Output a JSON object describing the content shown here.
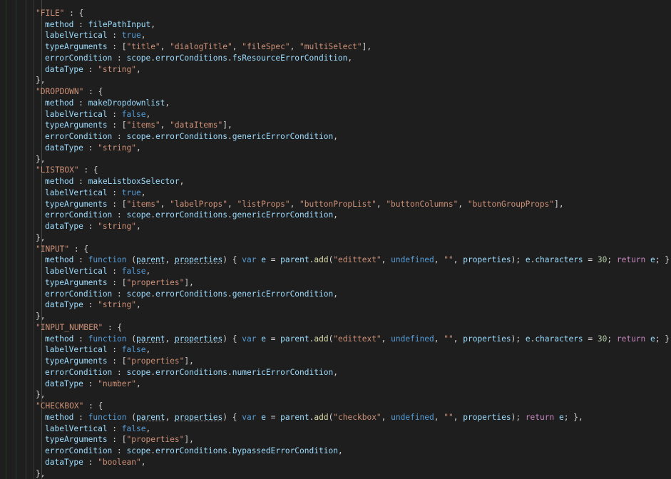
{
  "editor": {
    "lines": [
      [
        [
          "t",
          ""
        ]
      ],
      [
        [
          "s",
          "\"FILE\""
        ],
        [
          "t",
          " : {"
        ]
      ],
      [
        [
          "i",
          ""
        ],
        [
          "p",
          "method"
        ],
        [
          "t",
          " : "
        ],
        [
          "p",
          "filePathInput"
        ],
        [
          "t",
          ","
        ]
      ],
      [
        [
          "i",
          ""
        ],
        [
          "p",
          "labelVertical"
        ],
        [
          "t",
          " : "
        ],
        [
          "k",
          "true"
        ],
        [
          "t",
          ","
        ]
      ],
      [
        [
          "i",
          ""
        ],
        [
          "p",
          "typeArguments"
        ],
        [
          "t",
          " : ["
        ],
        [
          "s",
          "\"title\""
        ],
        [
          "t",
          ", "
        ],
        [
          "s",
          "\"dialogTitle\""
        ],
        [
          "t",
          ", "
        ],
        [
          "s",
          "\"fileSpec\""
        ],
        [
          "t",
          ", "
        ],
        [
          "s",
          "\"multiSelect\""
        ],
        [
          "t",
          "],"
        ]
      ],
      [
        [
          "i",
          ""
        ],
        [
          "p",
          "errorCondition"
        ],
        [
          "t",
          " : "
        ],
        [
          "p",
          "scope"
        ],
        [
          "t",
          "."
        ],
        [
          "p",
          "errorConditions"
        ],
        [
          "t",
          "."
        ],
        [
          "p",
          "fsResourceErrorCondition"
        ],
        [
          "t",
          ","
        ]
      ],
      [
        [
          "i",
          ""
        ],
        [
          "p",
          "dataType"
        ],
        [
          "t",
          " : "
        ],
        [
          "s",
          "\"string\""
        ],
        [
          "t",
          ","
        ]
      ],
      [
        [
          "t",
          "},"
        ]
      ],
      [
        [
          "s",
          "\"DROPDOWN\""
        ],
        [
          "t",
          " : {"
        ]
      ],
      [
        [
          "i",
          ""
        ],
        [
          "p",
          "method"
        ],
        [
          "t",
          " : "
        ],
        [
          "p",
          "makeDropdownlist"
        ],
        [
          "t",
          ","
        ]
      ],
      [
        [
          "i",
          ""
        ],
        [
          "p",
          "labelVertical"
        ],
        [
          "t",
          " : "
        ],
        [
          "k",
          "false"
        ],
        [
          "t",
          ","
        ]
      ],
      [
        [
          "i",
          ""
        ],
        [
          "p",
          "typeArguments"
        ],
        [
          "t",
          " : ["
        ],
        [
          "s",
          "\"items\""
        ],
        [
          "t",
          ", "
        ],
        [
          "s",
          "\"dataItems\""
        ],
        [
          "t",
          "],"
        ]
      ],
      [
        [
          "i",
          ""
        ],
        [
          "p",
          "errorCondition"
        ],
        [
          "t",
          " : "
        ],
        [
          "p",
          "scope"
        ],
        [
          "t",
          "."
        ],
        [
          "p",
          "errorConditions"
        ],
        [
          "t",
          "."
        ],
        [
          "p",
          "genericErrorCondition"
        ],
        [
          "t",
          ","
        ]
      ],
      [
        [
          "i",
          ""
        ],
        [
          "p",
          "dataType"
        ],
        [
          "t",
          " : "
        ],
        [
          "s",
          "\"string\""
        ],
        [
          "t",
          ","
        ]
      ],
      [
        [
          "t",
          "},"
        ]
      ],
      [
        [
          "s",
          "\"LISTBOX\""
        ],
        [
          "t",
          " : {"
        ]
      ],
      [
        [
          "i",
          ""
        ],
        [
          "p",
          "method"
        ],
        [
          "t",
          " : "
        ],
        [
          "p",
          "makeListboxSelector"
        ],
        [
          "t",
          ","
        ]
      ],
      [
        [
          "i",
          ""
        ],
        [
          "p",
          "labelVertical"
        ],
        [
          "t",
          " : "
        ],
        [
          "k",
          "true"
        ],
        [
          "t",
          ","
        ]
      ],
      [
        [
          "i",
          ""
        ],
        [
          "p",
          "typeArguments"
        ],
        [
          "t",
          " : ["
        ],
        [
          "s",
          "\"items\""
        ],
        [
          "t",
          ", "
        ],
        [
          "s",
          "\"labelProps\""
        ],
        [
          "t",
          ", "
        ],
        [
          "s",
          "\"listProps\""
        ],
        [
          "t",
          ", "
        ],
        [
          "s",
          "\"buttonPropList\""
        ],
        [
          "t",
          ", "
        ],
        [
          "s",
          "\"buttonColumns\""
        ],
        [
          "t",
          ", "
        ],
        [
          "s",
          "\"buttonGroupProps\""
        ],
        [
          "t",
          "],"
        ]
      ],
      [
        [
          "i",
          ""
        ],
        [
          "p",
          "errorCondition"
        ],
        [
          "t",
          " : "
        ],
        [
          "p",
          "scope"
        ],
        [
          "t",
          "."
        ],
        [
          "p",
          "errorConditions"
        ],
        [
          "t",
          "."
        ],
        [
          "p",
          "genericErrorCondition"
        ],
        [
          "t",
          ","
        ]
      ],
      [
        [
          "i",
          ""
        ],
        [
          "p",
          "dataType"
        ],
        [
          "t",
          " : "
        ],
        [
          "s",
          "\"string\""
        ],
        [
          "t",
          ","
        ]
      ],
      [
        [
          "t",
          "},"
        ]
      ],
      [
        [
          "s",
          "\"INPUT\""
        ],
        [
          "t",
          " : {"
        ]
      ],
      [
        [
          "i",
          ""
        ],
        [
          "p",
          "method"
        ],
        [
          "t",
          " : "
        ],
        [
          "k",
          "function"
        ],
        [
          "t",
          " ("
        ],
        [
          "pu",
          "parent"
        ],
        [
          "t",
          ", "
        ],
        [
          "pu",
          "properties"
        ],
        [
          "t",
          ") { "
        ],
        [
          "k",
          "var"
        ],
        [
          "t",
          " "
        ],
        [
          "p",
          "e"
        ],
        [
          "t",
          " = "
        ],
        [
          "p",
          "parent"
        ],
        [
          "t",
          "."
        ],
        [
          "f",
          "add"
        ],
        [
          "t",
          "("
        ],
        [
          "s",
          "\"edittext\""
        ],
        [
          "t",
          ", "
        ],
        [
          "k",
          "undefined"
        ],
        [
          "t",
          ", "
        ],
        [
          "s",
          "\"\""
        ],
        [
          "t",
          ", "
        ],
        [
          "p",
          "properties"
        ],
        [
          "t",
          "); "
        ],
        [
          "p",
          "e"
        ],
        [
          "t",
          "."
        ],
        [
          "p",
          "characters"
        ],
        [
          "t",
          " = "
        ],
        [
          "n",
          "30"
        ],
        [
          "t",
          "; "
        ],
        [
          "c",
          "return"
        ],
        [
          "t",
          " "
        ],
        [
          "p",
          "e"
        ],
        [
          "t",
          "; },"
        ]
      ],
      [
        [
          "i",
          ""
        ],
        [
          "p",
          "labelVertical"
        ],
        [
          "t",
          " : "
        ],
        [
          "k",
          "false"
        ],
        [
          "t",
          ","
        ]
      ],
      [
        [
          "i",
          ""
        ],
        [
          "p",
          "typeArguments"
        ],
        [
          "t",
          " : ["
        ],
        [
          "s",
          "\"properties\""
        ],
        [
          "t",
          "],"
        ]
      ],
      [
        [
          "i",
          ""
        ],
        [
          "p",
          "errorCondition"
        ],
        [
          "t",
          " : "
        ],
        [
          "p",
          "scope"
        ],
        [
          "t",
          "."
        ],
        [
          "p",
          "errorConditions"
        ],
        [
          "t",
          "."
        ],
        [
          "p",
          "genericErrorCondition"
        ],
        [
          "t",
          ","
        ]
      ],
      [
        [
          "i",
          ""
        ],
        [
          "p",
          "dataType"
        ],
        [
          "t",
          " : "
        ],
        [
          "s",
          "\"string\""
        ],
        [
          "t",
          ","
        ]
      ],
      [
        [
          "t",
          "},"
        ]
      ],
      [
        [
          "s",
          "\"INPUT_NUMBER\""
        ],
        [
          "t",
          " : {"
        ]
      ],
      [
        [
          "i",
          ""
        ],
        [
          "p",
          "method"
        ],
        [
          "t",
          " : "
        ],
        [
          "k",
          "function"
        ],
        [
          "t",
          " ("
        ],
        [
          "pu",
          "parent"
        ],
        [
          "t",
          ", "
        ],
        [
          "pu",
          "properties"
        ],
        [
          "t",
          ") { "
        ],
        [
          "k",
          "var"
        ],
        [
          "t",
          " "
        ],
        [
          "p",
          "e"
        ],
        [
          "t",
          " = "
        ],
        [
          "p",
          "parent"
        ],
        [
          "t",
          "."
        ],
        [
          "f",
          "add"
        ],
        [
          "t",
          "("
        ],
        [
          "s",
          "\"edittext\""
        ],
        [
          "t",
          ", "
        ],
        [
          "k",
          "undefined"
        ],
        [
          "t",
          ", "
        ],
        [
          "s",
          "\"\""
        ],
        [
          "t",
          ", "
        ],
        [
          "p",
          "properties"
        ],
        [
          "t",
          "); "
        ],
        [
          "p",
          "e"
        ],
        [
          "t",
          "."
        ],
        [
          "p",
          "characters"
        ],
        [
          "t",
          " = "
        ],
        [
          "n",
          "30"
        ],
        [
          "t",
          "; "
        ],
        [
          "c",
          "return"
        ],
        [
          "t",
          " "
        ],
        [
          "p",
          "e"
        ],
        [
          "t",
          "; },"
        ]
      ],
      [
        [
          "i",
          ""
        ],
        [
          "p",
          "labelVertical"
        ],
        [
          "t",
          " : "
        ],
        [
          "k",
          "false"
        ],
        [
          "t",
          ","
        ]
      ],
      [
        [
          "i",
          ""
        ],
        [
          "p",
          "typeArguments"
        ],
        [
          "t",
          " : ["
        ],
        [
          "s",
          "\"properties\""
        ],
        [
          "t",
          "],"
        ]
      ],
      [
        [
          "i",
          ""
        ],
        [
          "p",
          "errorCondition"
        ],
        [
          "t",
          " : "
        ],
        [
          "p",
          "scope"
        ],
        [
          "t",
          "."
        ],
        [
          "p",
          "errorConditions"
        ],
        [
          "t",
          "."
        ],
        [
          "p",
          "numericErrorCondition"
        ],
        [
          "t",
          ","
        ]
      ],
      [
        [
          "i",
          ""
        ],
        [
          "p",
          "dataType"
        ],
        [
          "t",
          " : "
        ],
        [
          "s",
          "\"number\""
        ],
        [
          "t",
          ","
        ]
      ],
      [
        [
          "t",
          "},"
        ]
      ],
      [
        [
          "s",
          "\"CHECKBOX\""
        ],
        [
          "t",
          " : {"
        ]
      ],
      [
        [
          "i",
          ""
        ],
        [
          "p",
          "method"
        ],
        [
          "t",
          " : "
        ],
        [
          "k",
          "function"
        ],
        [
          "t",
          " ("
        ],
        [
          "pu",
          "parent"
        ],
        [
          "t",
          ", "
        ],
        [
          "pu",
          "properties"
        ],
        [
          "t",
          ") { "
        ],
        [
          "k",
          "var"
        ],
        [
          "t",
          " "
        ],
        [
          "p",
          "e"
        ],
        [
          "t",
          " = "
        ],
        [
          "p",
          "parent"
        ],
        [
          "t",
          "."
        ],
        [
          "f",
          "add"
        ],
        [
          "t",
          "("
        ],
        [
          "s",
          "\"checkbox\""
        ],
        [
          "t",
          ", "
        ],
        [
          "k",
          "undefined"
        ],
        [
          "t",
          ", "
        ],
        [
          "s",
          "\"\""
        ],
        [
          "t",
          ", "
        ],
        [
          "p",
          "properties"
        ],
        [
          "t",
          "); "
        ],
        [
          "c",
          "return"
        ],
        [
          "t",
          " "
        ],
        [
          "p",
          "e"
        ],
        [
          "t",
          "; },"
        ]
      ],
      [
        [
          "i",
          ""
        ],
        [
          "p",
          "labelVertical"
        ],
        [
          "t",
          " : "
        ],
        [
          "k",
          "false"
        ],
        [
          "t",
          ","
        ]
      ],
      [
        [
          "i",
          ""
        ],
        [
          "p",
          "typeArguments"
        ],
        [
          "t",
          " : ["
        ],
        [
          "s",
          "\"properties\""
        ],
        [
          "t",
          "],"
        ]
      ],
      [
        [
          "i",
          ""
        ],
        [
          "p",
          "errorCondition"
        ],
        [
          "t",
          " : "
        ],
        [
          "p",
          "scope"
        ],
        [
          "t",
          "."
        ],
        [
          "p",
          "errorConditions"
        ],
        [
          "t",
          "."
        ],
        [
          "p",
          "bypassedErrorCondition"
        ],
        [
          "t",
          ","
        ]
      ],
      [
        [
          "i",
          ""
        ],
        [
          "p",
          "dataType"
        ],
        [
          "t",
          " : "
        ],
        [
          "s",
          "\"boolean\""
        ],
        [
          "t",
          ","
        ]
      ],
      [
        [
          "t",
          "},"
        ]
      ]
    ]
  }
}
